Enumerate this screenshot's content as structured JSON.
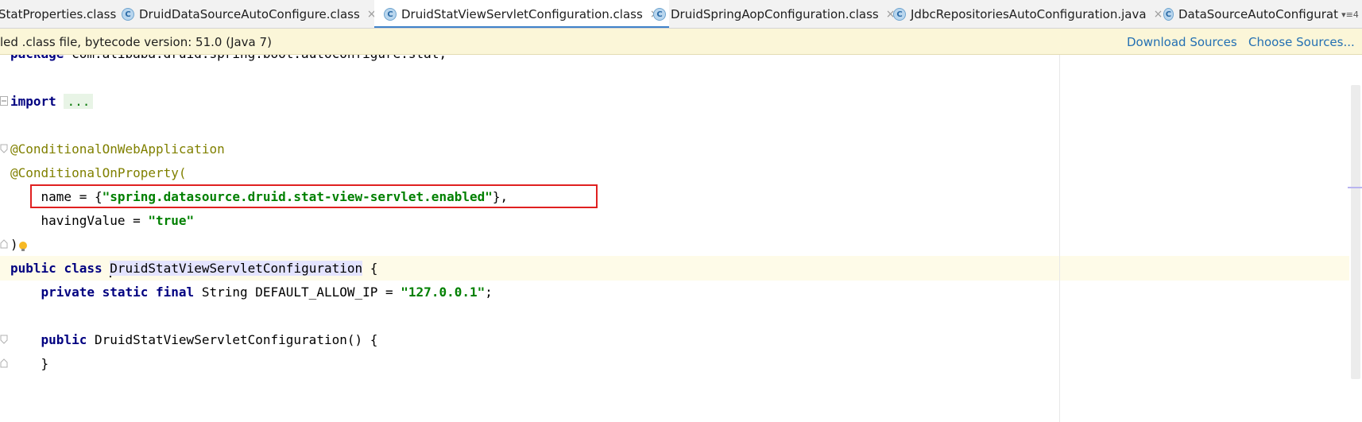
{
  "tabs": [
    {
      "label": "StatProperties.class",
      "icon": "class-file-icon",
      "active": false,
      "partial": true
    },
    {
      "label": "DruidDataSourceAutoConfigure.class",
      "icon": "class-file-icon",
      "active": false
    },
    {
      "label": "DruidStatViewServletConfiguration.class",
      "icon": "class-file-icon",
      "active": true
    },
    {
      "label": "DruidSpringAopConfiguration.class",
      "icon": "class-file-icon",
      "active": false
    },
    {
      "label": "JdbcRepositoriesAutoConfiguration.java",
      "icon": "class-file-icon",
      "active": false
    },
    {
      "label": "DataSourceAutoConfigurat",
      "icon": "class-file-icon",
      "active": false,
      "partial": true
    }
  ],
  "tab_icon_letter": "C",
  "tab_close_glyph": "×",
  "tab_menu_glyph": "▾≡4",
  "infobar": {
    "message": "led .class file, bytecode version: 51.0 (Java 7)",
    "download_sources": "Download Sources",
    "choose_sources": "Choose Sources..."
  },
  "code": {
    "package_kw": "package",
    "package_name": " com.alibaba.druid.spring.boot.autoconfigure.stat;",
    "import_kw": "import",
    "import_fold": "...",
    "ann1": "@ConditionalOnWebApplication",
    "ann2": "@ConditionalOnProperty(",
    "name_key": "    name = {",
    "name_value": "\"spring.datasource.druid.stat-view-servlet.enabled\"",
    "name_end": "},",
    "having_key": "    havingValue = ",
    "having_value": "\"true\"",
    "close_paren": ")",
    "public_kw": "public",
    "class_kw": "class",
    "class_name": "DruidStatViewServletConfiguration",
    "class_open": " {",
    "field_mods": "private static final",
    "field_rest": " String DEFAULT_ALLOW_IP = ",
    "field_value": "\"127.0.0.1\"",
    "field_end": ";",
    "ctor_public": "public",
    "ctor_rest": " DruidStatViewServletConfiguration() {",
    "ctor_close": "    }"
  },
  "colors": {
    "keyword": "#000080",
    "string": "#008000",
    "highlight_box": "#e02020",
    "active_tab_underline": "#4083c9",
    "link": "#2470b3",
    "infobar_bg": "#fbf6d8"
  }
}
